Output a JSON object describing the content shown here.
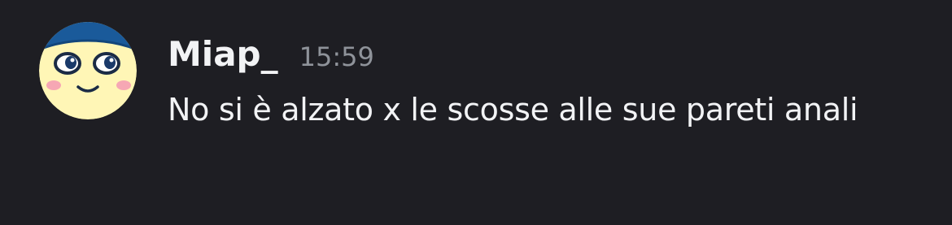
{
  "message": {
    "author": {
      "username": "Miap_",
      "avatar_icon": "smiley-face-avatar-icon"
    },
    "timestamp": "15:59",
    "text": "No si è alzato x le scosse alle sue pareti anali"
  },
  "colors": {
    "background": "#1e1e23",
    "username": "#f2f3f5",
    "timestamp": "#8f939a",
    "message_text": "#f2f3f5",
    "avatar_face": "#fff6b6",
    "avatar_hat": "#1a5a9a",
    "avatar_blush": "#f6a7b4"
  }
}
